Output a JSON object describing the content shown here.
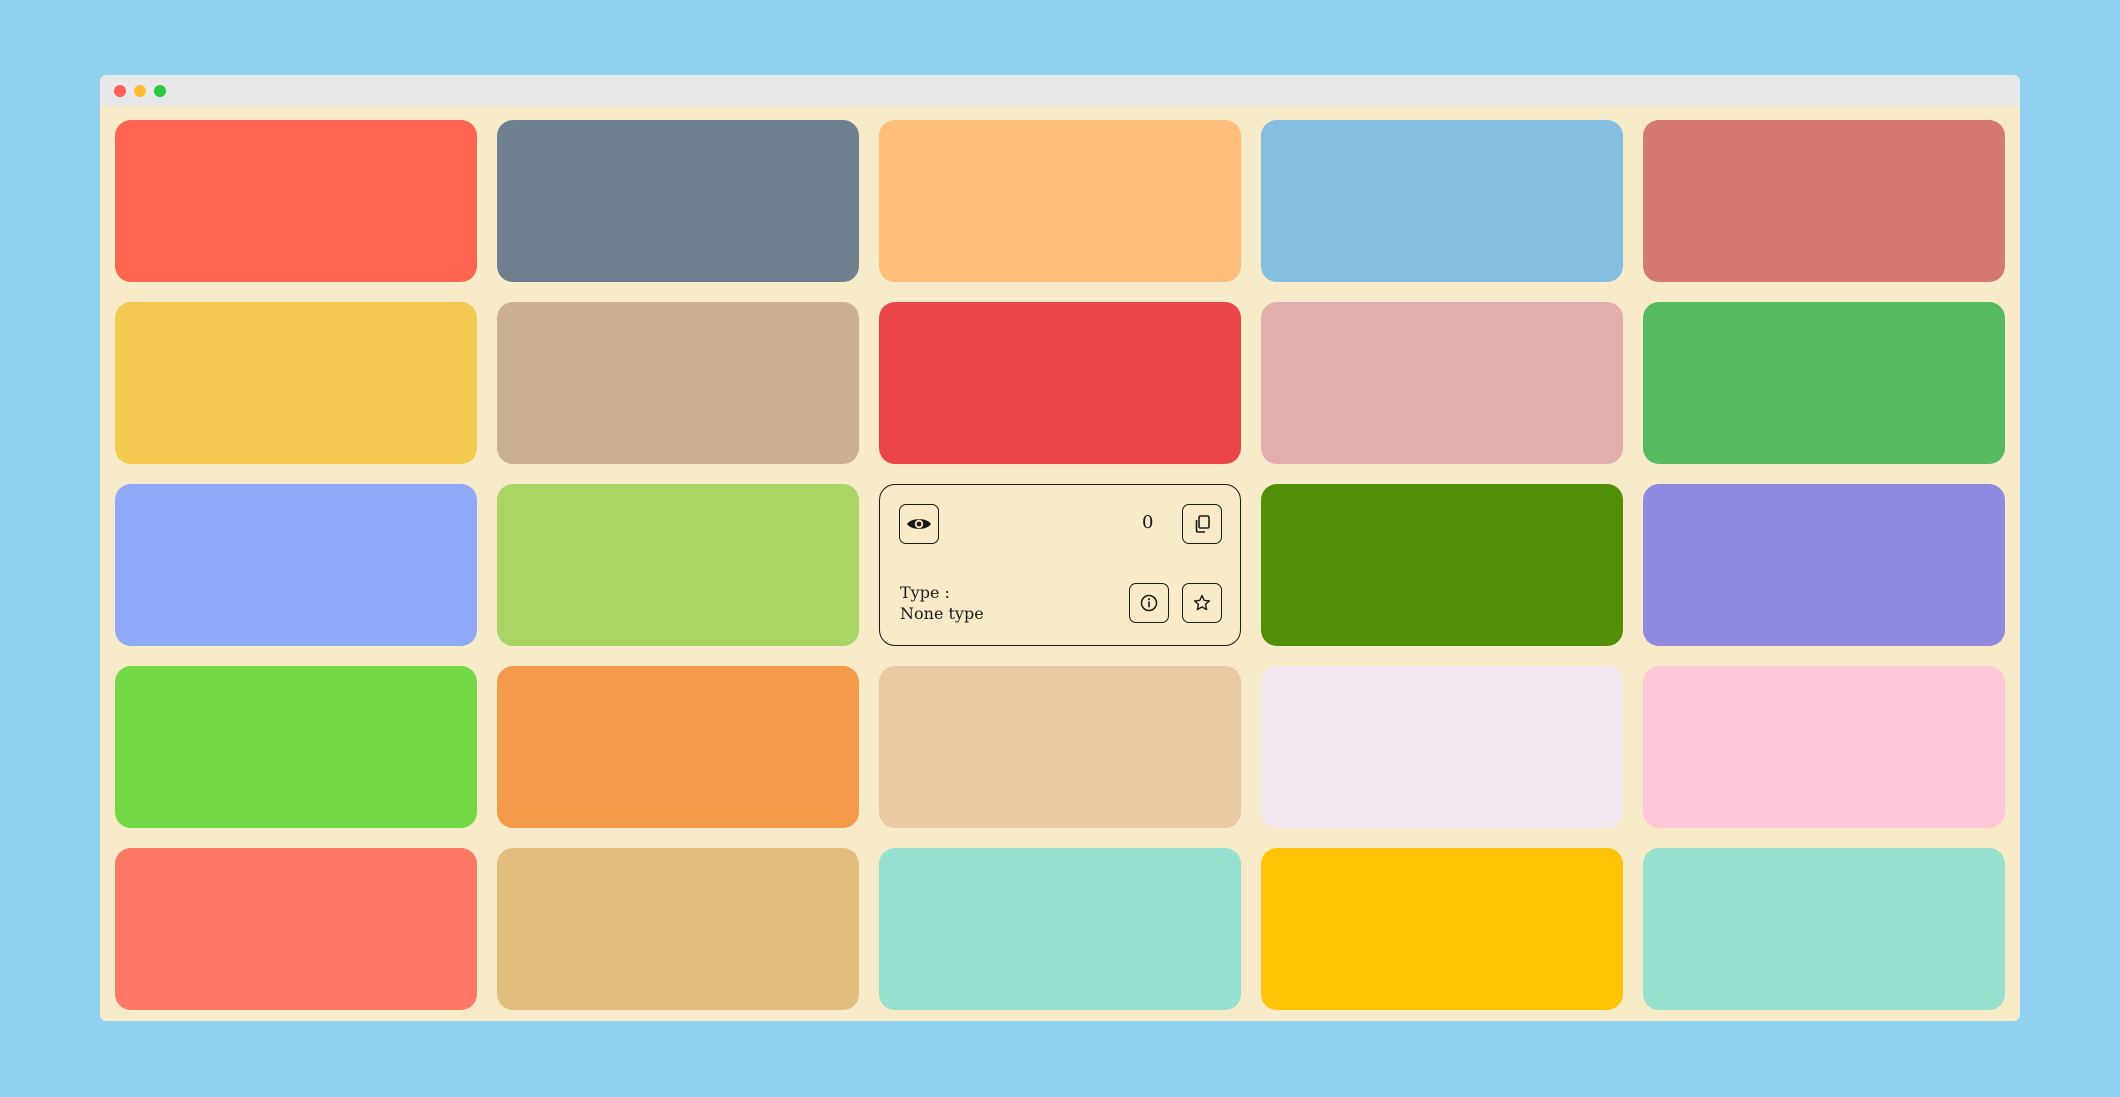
{
  "window": {
    "buttons": [
      "close",
      "minimize",
      "maximize"
    ]
  },
  "colors": [
    "#ff6450",
    "#6e8090",
    "#ffbe7a",
    "#84bee0",
    "#d67a70",
    "#f4c94f",
    "#cab093",
    "#ea4648",
    "#e3adad",
    "#56ba5f",
    "#90a8f8",
    "#a8d563",
    "#f8ebc9",
    "#508f07",
    "#8f8ae0",
    "#72d846",
    "#f39b4b",
    "#e9caa2",
    "#f3e8f1",
    "#ffc8d8",
    "#ff7866",
    "#e1be7e",
    "#96e0d0",
    "#ffc306",
    "#96e0d0"
  ],
  "active_index": 12,
  "active_card": {
    "count": "0",
    "type_label": "Type :",
    "type_value": "None type",
    "icons": {
      "view": "eye-icon",
      "copy": "copy-icon",
      "info": "info-icon",
      "favorite": "star-icon"
    }
  }
}
